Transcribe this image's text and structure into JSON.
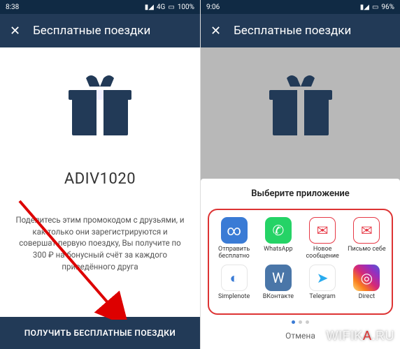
{
  "left": {
    "status": {
      "time": "8:38",
      "net": "4G",
      "battery": "100%"
    },
    "header": {
      "title": "Бесплатные поездки"
    },
    "promo_code": "ADIV1020",
    "description": "Поделитесь этим промокодом с друзьями, и как только они зарегистрируются и совершат первую поездку, Вы получите по 300 ₽ на бонусный счёт за каждого приведённого друга",
    "cta_label": "ПОЛУЧИТЬ БЕСПЛАТНЫЕ ПОЕЗДКИ"
  },
  "right": {
    "status": {
      "time": "9:06",
      "net": "",
      "battery": "96%"
    },
    "header": {
      "title": "Бесплатные поездки"
    },
    "sheet": {
      "title": "Выберите приложение",
      "apps": [
        {
          "id": "share-free",
          "label": "Отправить бесплатно",
          "bg": "#3a7bd5",
          "glyph": "∞"
        },
        {
          "id": "whatsapp",
          "label": "WhatsApp",
          "bg": "#25d366",
          "glyph": "✆"
        },
        {
          "id": "new-message",
          "label": "Новое сообщение",
          "bg": "#ffffff",
          "glyph": "✉",
          "fg": "#e63946",
          "border": "#e63946"
        },
        {
          "id": "mail-self",
          "label": "Письмо себе",
          "bg": "#ffffff",
          "glyph": "✉",
          "fg": "#e63946",
          "border": "#e63946"
        },
        {
          "id": "simplenote",
          "label": "Simplenote",
          "bg": "#ffffff",
          "glyph": "◐",
          "fg": "#3a7bd5",
          "border": "#e5e5e5"
        },
        {
          "id": "vk",
          "label": "ВКонтакте",
          "bg": "#4a76a8",
          "glyph": "W"
        },
        {
          "id": "telegram",
          "label": "Telegram",
          "bg": "#ffffff",
          "glyph": "➤",
          "fg": "#2aabee",
          "border": "#e5e5e5"
        },
        {
          "id": "direct",
          "label": "Direct",
          "bg": "linear-gradient(45deg,#feda75,#fa7e1e,#d62976,#962fbf,#4f5bd5)",
          "glyph": "◎"
        }
      ],
      "cancel": "Отмена"
    }
  },
  "watermark": {
    "prefix": "WIFIK",
    "a": "A",
    "suffix": ".RU"
  }
}
